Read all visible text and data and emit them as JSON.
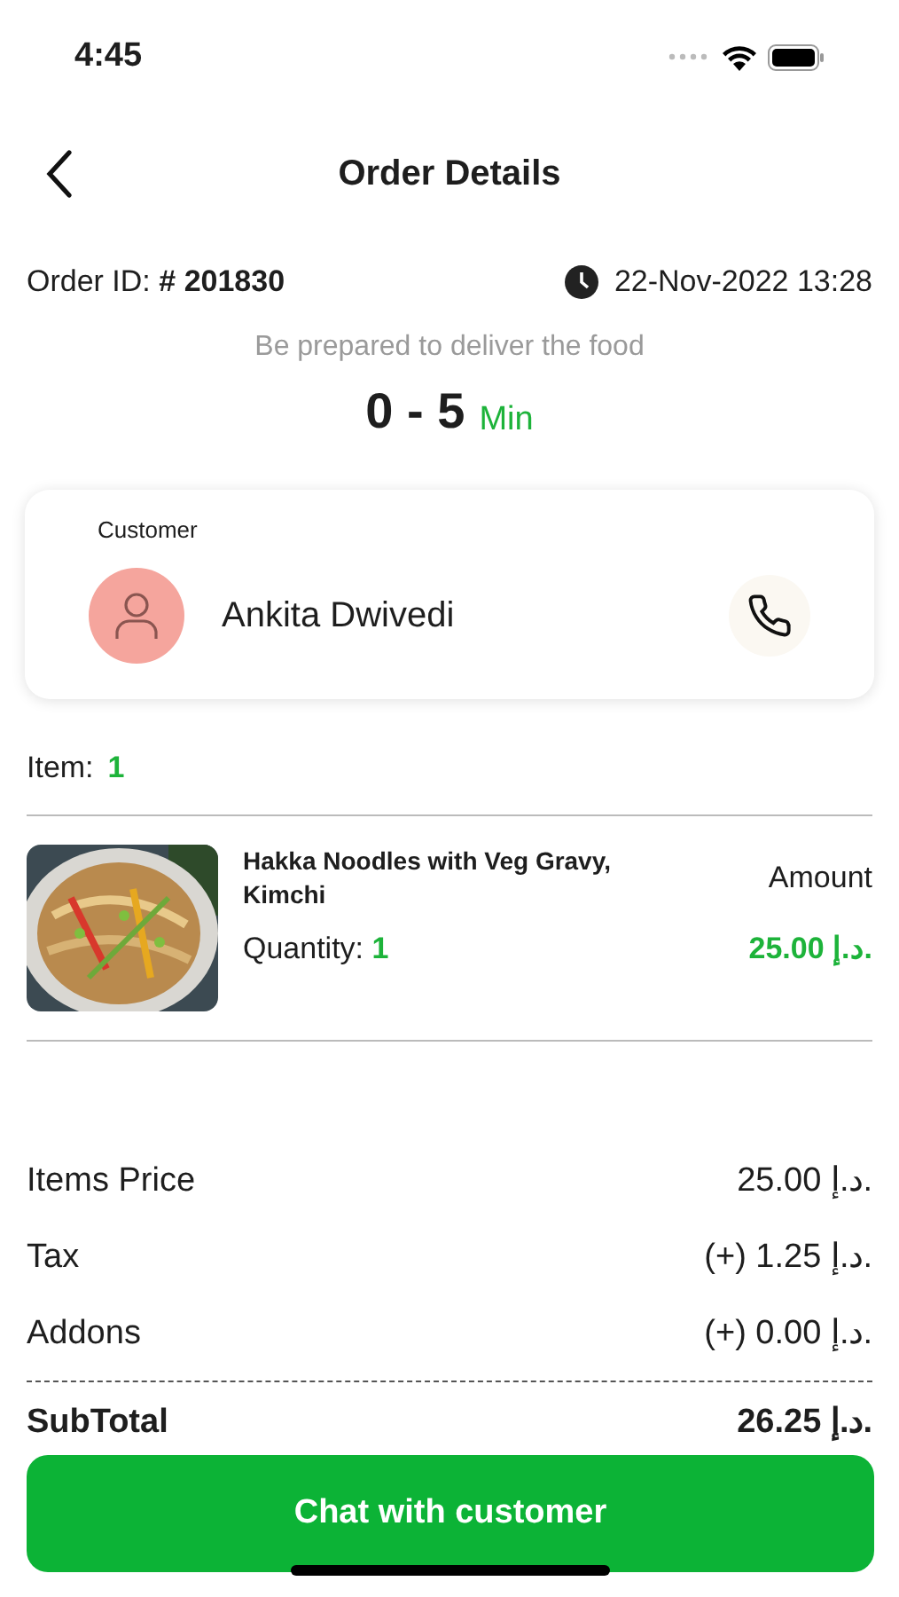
{
  "status_bar": {
    "time": "4:45"
  },
  "header": {
    "title": "Order Details"
  },
  "order": {
    "id_label": "Order ID:",
    "id_value": "# 201830",
    "datetime": "22-Nov-2022 13:28",
    "note": "Be prepared to deliver the food",
    "time_range": "0 - 5",
    "time_unit": "Min"
  },
  "customer": {
    "label": "Customer",
    "name": "Ankita Dwivedi"
  },
  "items_summary": {
    "label": "Item:",
    "count": "1"
  },
  "items": [
    {
      "name": "Hakka Noodles with Veg Gravy, Kimchi",
      "quantity_label": "Quantity:",
      "quantity": "1",
      "amount_label": "Amount",
      "amount": "25.00 د.إ."
    }
  ],
  "price_rows": [
    {
      "label": "Items Price",
      "value": "25.00 د.إ.",
      "kind": "plain"
    },
    {
      "label": "Tax",
      "value": "(+) 1.25 د.إ.",
      "kind": "plain"
    },
    {
      "label": "Addons",
      "value": "(+) 0.00 د.إ.",
      "kind": "plain"
    },
    {
      "kind": "divider"
    },
    {
      "label": "SubTotal",
      "value": "26.25 د.إ.",
      "kind": "bold"
    }
  ],
  "action_button": {
    "label": "Chat with customer"
  }
}
